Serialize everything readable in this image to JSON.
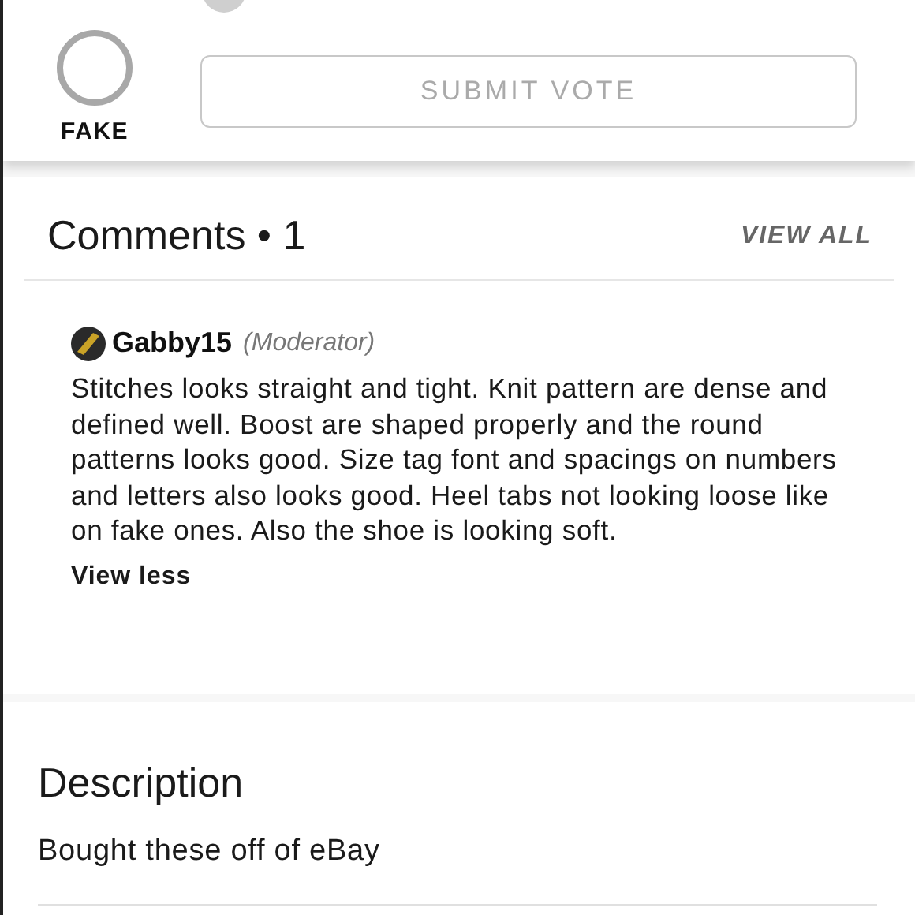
{
  "vote": {
    "options": [
      {
        "label": "FAKE",
        "selected": false
      }
    ],
    "submit_button": {
      "label": "SUBMIT VOTE",
      "disabled": true
    }
  },
  "comments": {
    "title": "Comments • 1",
    "view_all": "VIEW ALL",
    "items": [
      {
        "author": "Gabby15",
        "role": "(Moderator)",
        "text": "Stitches looks straight and tight. Knit pattern are dense and defined well. Boost are shaped properly and the round patterns looks good. Size tag font and spacings on numbers and letters also looks good. Heel tabs not looking loose like on fake ones. Also the shoe is looking soft.",
        "toggle": "View less"
      }
    ]
  },
  "description": {
    "title": "Description",
    "text": "Bought these off of eBay"
  }
}
